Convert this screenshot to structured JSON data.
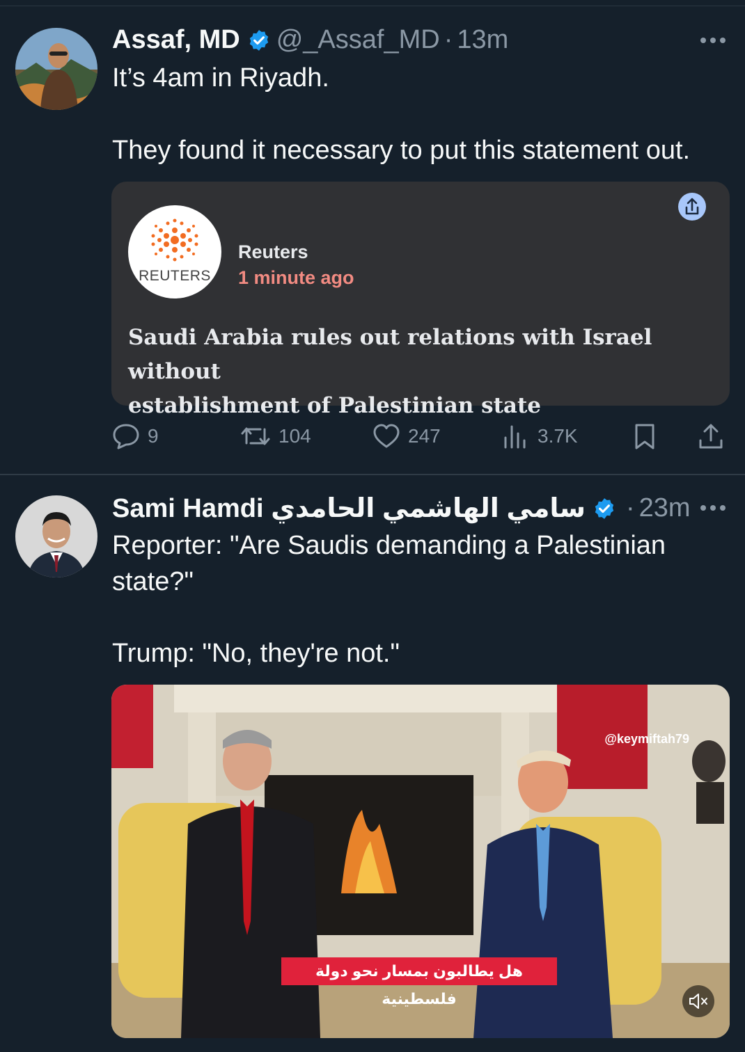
{
  "tweets": [
    {
      "display_name": "Assaf, MD",
      "handle": "@_Assaf_MD",
      "separator": "·",
      "time": "13m",
      "text_lines": [
        "It’s 4am in Riyadh.",
        "They found it necessary to put this statement out."
      ],
      "quote_card": {
        "logo_text": "REUTERS",
        "source": "Reuters",
        "time": "1 minute ago",
        "headline_lines": [
          "Saudi Arabia rules out relations with Israel without",
          "establishment of Palestinian state"
        ],
        "share_icon": "share-icon"
      },
      "actions": {
        "replies": "9",
        "reposts": "104",
        "likes": "247",
        "views": "3.7K"
      }
    },
    {
      "display_name": "Sami Hamdi سامي الهاشمي الحامدي",
      "separator": "·",
      "time": "23m",
      "text_lines": [
        "Reporter: \"Are Saudis demanding a Palestinian",
        "state?\"",
        "Trump: \"No, they're not.\""
      ],
      "media": {
        "watermark": "@keymiftah79",
        "caption": "هل يطالبون بمسار نحو دولة فلسطينية",
        "mute_icon": "mute-icon"
      }
    }
  ],
  "colors": {
    "background": "#15202b",
    "text": "#f7f9f9",
    "muted": "#8b98a5",
    "verified": "#1d9bf0",
    "card_bg": "#303134",
    "card_time": "#f28b82",
    "caption_bg": "#e0223b"
  }
}
